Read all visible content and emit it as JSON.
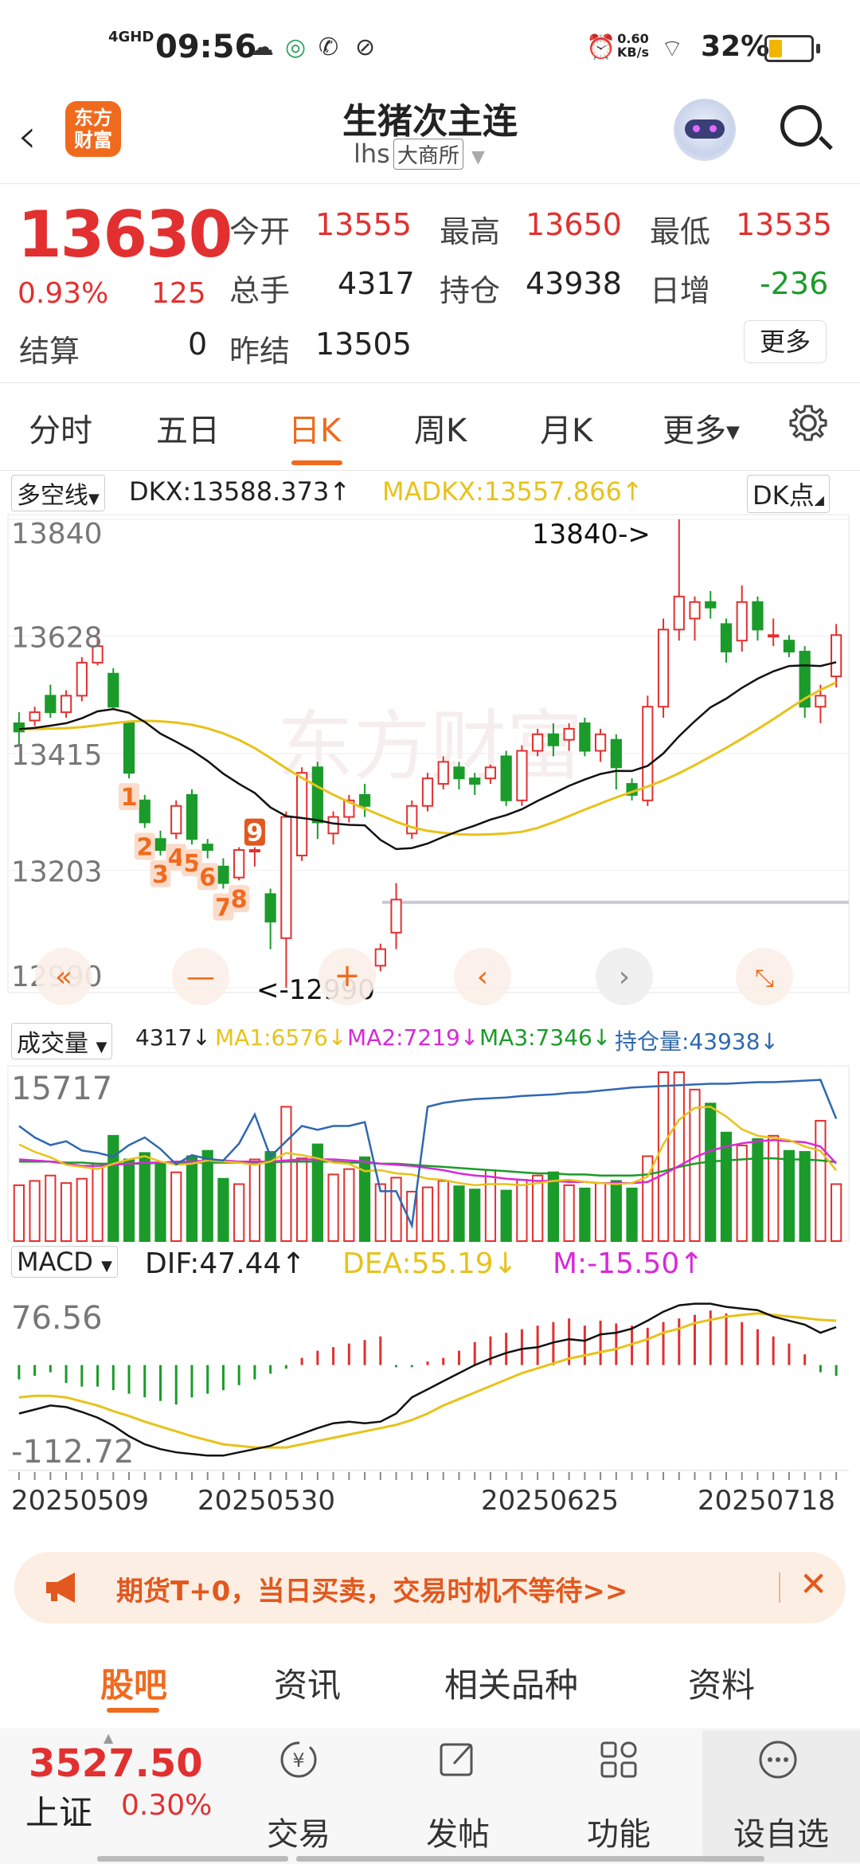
{
  "status_bar": {
    "network": "4GHD",
    "time": "09:56",
    "speed_value": "0.60",
    "speed_unit": "KB/s",
    "battery_pct": "32%",
    "battery_level": 0.32
  },
  "header": {
    "logo_line1": "东方",
    "logo_line2": "财富",
    "title": "生猪次主连",
    "code": "lhs",
    "exchange": "大商所"
  },
  "quote": {
    "last": "13630",
    "change_pct": "0.93%",
    "change": "125",
    "open_label": "今开",
    "open": "13555",
    "high_label": "最高",
    "high": "13650",
    "low_label": "最低",
    "low": "13535",
    "volume_label": "总手",
    "volume": "4317",
    "oi_label": "持仓",
    "oi": "43938",
    "oi_chg_label": "日增",
    "oi_chg": "-236",
    "settle_label": "结算",
    "settle": "0",
    "prev_settle_label": "昨结",
    "prev_settle": "13505",
    "more_label": "更多"
  },
  "period_tabs": [
    "分时",
    "五日",
    "日K",
    "周K",
    "月K",
    "更多"
  ],
  "period_active": 2,
  "indicator": {
    "select": "多空线",
    "dkx": "DKX:13588.373↑",
    "madkx": "MADKX:13557.866↑",
    "dk_button": "DK点"
  },
  "volume_panel": {
    "select": "成交量",
    "vol": "4317↓",
    "ma1": "MA1:6576↓",
    "ma2": "MA2:7219↓",
    "ma3": "MA3:7346↓",
    "oi": "持仓量:43938↓",
    "top_label": "15717"
  },
  "macd_panel": {
    "select": "MACD",
    "dif": "DIF:47.44↑",
    "dea": "DEA:55.19↓",
    "m": "M:-15.50↑",
    "top_label": "76.56",
    "bottom_label": "-112.72"
  },
  "chart_data": {
    "type": "candlestick",
    "y_ticks": [
      "13840",
      "13628",
      "13415",
      "13203",
      "12990"
    ],
    "ylim": [
      12990,
      13840
    ],
    "max_annotation": "13840->",
    "min_annotation": "<-12990",
    "x_dates": [
      "20250509",
      "20250530",
      "20250625",
      "20250718"
    ],
    "pattern_markers": [
      "1",
      "2",
      "3",
      "4",
      "5",
      "6",
      "7",
      "8",
      "9"
    ],
    "candles": [
      {
        "o": 13470,
        "c": 13455,
        "h": 13490,
        "l": 13430,
        "up": false
      },
      {
        "o": 13475,
        "c": 13490,
        "h": 13500,
        "l": 13465,
        "up": true
      },
      {
        "o": 13520,
        "c": 13490,
        "h": 13540,
        "l": 13480,
        "up": false
      },
      {
        "o": 13490,
        "c": 13520,
        "h": 13530,
        "l": 13480,
        "up": true
      },
      {
        "o": 13520,
        "c": 13580,
        "h": 13590,
        "l": 13510,
        "up": true
      },
      {
        "o": 13580,
        "c": 13610,
        "h": 13628,
        "l": 13575,
        "up": true
      },
      {
        "o": 13560,
        "c": 13500,
        "h": 13570,
        "l": 13495,
        "up": false
      },
      {
        "o": 13470,
        "c": 13380,
        "h": 13475,
        "l": 13370,
        "up": false
      },
      {
        "o": 13330,
        "c": 13290,
        "h": 13340,
        "l": 13280,
        "up": false
      },
      {
        "o": 13260,
        "c": 13240,
        "h": 13275,
        "l": 13230,
        "up": false
      },
      {
        "o": 13270,
        "c": 13320,
        "h": 13330,
        "l": 13260,
        "up": true
      },
      {
        "o": 13340,
        "c": 13260,
        "h": 13350,
        "l": 13250,
        "up": false
      },
      {
        "o": 13250,
        "c": 13240,
        "h": 13260,
        "l": 13225,
        "up": false
      },
      {
        "o": 13210,
        "c": 13180,
        "h": 13225,
        "l": 13170,
        "up": false
      },
      {
        "o": 13190,
        "c": 13240,
        "h": 13245,
        "l": 13185,
        "up": true
      },
      {
        "o": 13240,
        "c": 13240,
        "h": 13245,
        "l": 13210,
        "up": true
      },
      {
        "o": 13160,
        "c": 13110,
        "h": 13170,
        "l": 13060,
        "up": false
      },
      {
        "o": 13080,
        "c": 13300,
        "h": 13310,
        "l": 12990,
        "up": true
      },
      {
        "o": 13230,
        "c": 13380,
        "h": 13390,
        "l": 13220,
        "up": true
      },
      {
        "o": 13390,
        "c": 13290,
        "h": 13400,
        "l": 13260,
        "up": false
      },
      {
        "o": 13270,
        "c": 13300,
        "h": 13310,
        "l": 13250,
        "up": true
      },
      {
        "o": 13300,
        "c": 13330,
        "h": 13340,
        "l": 13290,
        "up": true
      },
      {
        "o": 13340,
        "c": 13320,
        "h": 13360,
        "l": 13300,
        "up": false
      },
      {
        "o": 13030,
        "c": 13060,
        "h": 13070,
        "l": 13020,
        "up": true
      },
      {
        "o": 13090,
        "c": 13150,
        "h": 13180,
        "l": 13060,
        "up": true
      },
      {
        "o": 13270,
        "c": 13320,
        "h": 13330,
        "l": 13260,
        "up": true
      },
      {
        "o": 13320,
        "c": 13370,
        "h": 13380,
        "l": 13310,
        "up": true
      },
      {
        "o": 13360,
        "c": 13400,
        "h": 13410,
        "l": 13350,
        "up": true
      },
      {
        "o": 13390,
        "c": 13370,
        "h": 13400,
        "l": 13350,
        "up": false
      },
      {
        "o": 13370,
        "c": 13360,
        "h": 13380,
        "l": 13340,
        "up": false
      },
      {
        "o": 13370,
        "c": 13390,
        "h": 13395,
        "l": 13360,
        "up": true
      },
      {
        "o": 13410,
        "c": 13330,
        "h": 13420,
        "l": 13320,
        "up": false
      },
      {
        "o": 13330,
        "c": 13420,
        "h": 13430,
        "l": 13320,
        "up": true
      },
      {
        "o": 13420,
        "c": 13450,
        "h": 13460,
        "l": 13410,
        "up": true
      },
      {
        "o": 13450,
        "c": 13430,
        "h": 13470,
        "l": 13410,
        "up": false
      },
      {
        "o": 13440,
        "c": 13460,
        "h": 13470,
        "l": 13420,
        "up": true
      },
      {
        "o": 13470,
        "c": 13420,
        "h": 13480,
        "l": 13410,
        "up": false
      },
      {
        "o": 13420,
        "c": 13450,
        "h": 13460,
        "l": 13400,
        "up": true
      },
      {
        "o": 13440,
        "c": 13390,
        "h": 13450,
        "l": 13350,
        "up": false
      },
      {
        "o": 13360,
        "c": 13340,
        "h": 13370,
        "l": 13330,
        "up": false
      },
      {
        "o": 13330,
        "c": 13500,
        "h": 13520,
        "l": 13320,
        "up": true
      },
      {
        "o": 13500,
        "c": 13640,
        "h": 13660,
        "l": 13480,
        "up": true
      },
      {
        "o": 13640,
        "c": 13700,
        "h": 13840,
        "l": 13620,
        "up": true
      },
      {
        "o": 13660,
        "c": 13690,
        "h": 13700,
        "l": 13620,
        "up": true
      },
      {
        "o": 13690,
        "c": 13680,
        "h": 13710,
        "l": 13660,
        "up": false
      },
      {
        "o": 13650,
        "c": 13600,
        "h": 13660,
        "l": 13580,
        "up": false
      },
      {
        "o": 13620,
        "c": 13690,
        "h": 13720,
        "l": 13600,
        "up": true
      },
      {
        "o": 13690,
        "c": 13640,
        "h": 13700,
        "l": 13620,
        "up": false
      },
      {
        "o": 13630,
        "c": 13630,
        "h": 13660,
        "l": 13610,
        "up": true
      },
      {
        "o": 13620,
        "c": 13600,
        "h": 13630,
        "l": 13590,
        "up": false
      },
      {
        "o": 13600,
        "c": 13500,
        "h": 13610,
        "l": 13480,
        "up": false
      },
      {
        "o": 13500,
        "c": 13520,
        "h": 13540,
        "l": 13470,
        "up": true
      },
      {
        "o": 13555,
        "c": 13630,
        "h": 13650,
        "l": 13535,
        "up": true
      }
    ],
    "volume_series_up": [
      true,
      true,
      true,
      true,
      true,
      true,
      false,
      false,
      false,
      false,
      true,
      false,
      false,
      false,
      true,
      true,
      false,
      true,
      true,
      false,
      true,
      true,
      false,
      true,
      true,
      true,
      true,
      true,
      false,
      false,
      true,
      false,
      true,
      true,
      false,
      true,
      false,
      true,
      false,
      false,
      true,
      true,
      true,
      true,
      false,
      false,
      true,
      false,
      true,
      false,
      false,
      true,
      true
    ],
    "volume_values": [
      5200,
      5600,
      6100,
      5400,
      5800,
      7200,
      9800,
      7600,
      8200,
      7200,
      6400,
      7900,
      8400,
      5800,
      5300,
      7600,
      8300,
      12500,
      7700,
      9000,
      6200,
      6700,
      7800,
      5300,
      5900,
      4600,
      5000,
      5600,
      5100,
      4800,
      6600,
      4700,
      5700,
      6100,
      6400,
      5200,
      4900,
      5400,
      5600,
      4900,
      7900,
      15717,
      15717,
      14100,
      12800,
      10100,
      8900,
      9500,
      9800,
      8400,
      8300,
      11200,
      5300
    ],
    "volume_ylim": [
      0,
      15717
    ],
    "macd_hist": [
      -20,
      -15,
      -10,
      -25,
      -30,
      -30,
      -35,
      -40,
      -45,
      -50,
      -55,
      -45,
      -40,
      -35,
      -28,
      -20,
      -12,
      -5,
      10,
      20,
      25,
      30,
      35,
      40,
      -3,
      -3,
      5,
      10,
      20,
      32,
      40,
      45,
      50,
      55,
      60,
      65,
      55,
      62,
      58,
      55,
      52,
      60,
      65,
      70,
      76,
      72,
      60,
      50,
      40,
      30,
      15,
      -10,
      -15
    ],
    "dif": [
      -60,
      -55,
      -50,
      -52,
      -58,
      -65,
      -75,
      -88,
      -98,
      -104,
      -108,
      -110,
      -112,
      -112,
      -108,
      -104,
      -100,
      -92,
      -85,
      -78,
      -72,
      -70,
      -72,
      -70,
      -60,
      -40,
      -30,
      -20,
      -10,
      0,
      8,
      15,
      20,
      22,
      28,
      32,
      30,
      38,
      40,
      45,
      55,
      66,
      74,
      76,
      76,
      72,
      70,
      68,
      60,
      55,
      50,
      40,
      47
    ],
    "dea": [
      -40,
      -38,
      -38,
      -40,
      -45,
      -50,
      -57,
      -63,
      -70,
      -76,
      -82,
      -88,
      -93,
      -98,
      -100,
      -102,
      -102,
      -102,
      -98,
      -94,
      -90,
      -86,
      -82,
      -78,
      -74,
      -68,
      -60,
      -50,
      -42,
      -34,
      -26,
      -18,
      -10,
      -4,
      2,
      8,
      12,
      16,
      20,
      26,
      32,
      40,
      45,
      52,
      56,
      60,
      62,
      64,
      62,
      60,
      58,
      56,
      55
    ],
    "ma1": [
      9000,
      8300,
      7800,
      7100,
      6900,
      6700,
      7200,
      7600,
      7900,
      7400,
      7100,
      7200,
      7500,
      7400,
      7300,
      7100,
      7400,
      8200,
      8000,
      7700,
      7300,
      7200,
      6500,
      6600,
      6300,
      6200,
      5800,
      5700,
      5400,
      5200,
      5300,
      5300,
      5200,
      5400,
      5600,
      5700,
      5500,
      5400,
      5300,
      5400,
      6000,
      9000,
      11300,
      12400,
      12500,
      11600,
      10400,
      9800,
      9600,
      9400,
      8800,
      8400,
      6576
    ],
    "ma2": [
      7600,
      7500,
      7400,
      7200,
      7000,
      7000,
      7100,
      7200,
      7300,
      7300,
      7400,
      7400,
      7500,
      7500,
      7400,
      7400,
      7400,
      7500,
      7600,
      7600,
      7600,
      7500,
      7400,
      7200,
      7100,
      7000,
      6800,
      6600,
      6300,
      6100,
      6000,
      5800,
      5700,
      5600,
      5600,
      5500,
      5500,
      5400,
      5400,
      5400,
      5500,
      6200,
      7000,
      7800,
      8400,
      8800,
      9100,
      9300,
      9400,
      9300,
      9200,
      8800,
      7219
    ],
    "ma3": [
      7400,
      7400,
      7400,
      7300,
      7300,
      7200,
      7200,
      7200,
      7200,
      7300,
      7300,
      7300,
      7300,
      7300,
      7300,
      7300,
      7300,
      7400,
      7400,
      7400,
      7400,
      7300,
      7300,
      7200,
      7200,
      7100,
      7000,
      6900,
      6800,
      6700,
      6600,
      6500,
      6400,
      6300,
      6300,
      6200,
      6200,
      6100,
      6100,
      6100,
      6200,
      6500,
      6900,
      7200,
      7400,
      7500,
      7600,
      7700,
      7700,
      7600,
      7600,
      7500,
      7346
    ],
    "oi_series": [
      43000,
      41500,
      40500,
      41000,
      39800,
      39500,
      39000,
      40500,
      41500,
      40000,
      38000,
      39200,
      38700,
      38500,
      40700,
      44500,
      39000,
      41000,
      43000,
      42500,
      43000,
      43000,
      43500,
      34500,
      34500,
      30000,
      45500,
      46000,
      46300,
      46500,
      46600,
      46700,
      46900,
      47000,
      47100,
      47300,
      47400,
      47600,
      47800,
      48000,
      48100,
      48200,
      48300,
      48400,
      48500,
      48500,
      48600,
      48700,
      48700,
      48800,
      48900,
      49000,
      43938
    ],
    "oi_ylim": [
      28000,
      50000
    ]
  },
  "banner": {
    "text": "期货T+0，当日买卖，交易时机不等待>>"
  },
  "content_tabs": [
    "股吧",
    "资讯",
    "相关品种",
    "资料"
  ],
  "content_active": 0,
  "bottom_nav": {
    "index_value": "3527.50",
    "index_name": "上证",
    "index_pct": "0.30%",
    "buttons": [
      "交易",
      "发帖",
      "功能",
      "设自选"
    ]
  },
  "colors": {
    "accent": "#f06a1e",
    "up": "#e23030",
    "down": "#1b9b2a",
    "dkx": "#111111",
    "madkx": "#e8c21a",
    "ma2": "#d829d8",
    "ma3": "#1b9b2a",
    "oi": "#2f68b0"
  }
}
